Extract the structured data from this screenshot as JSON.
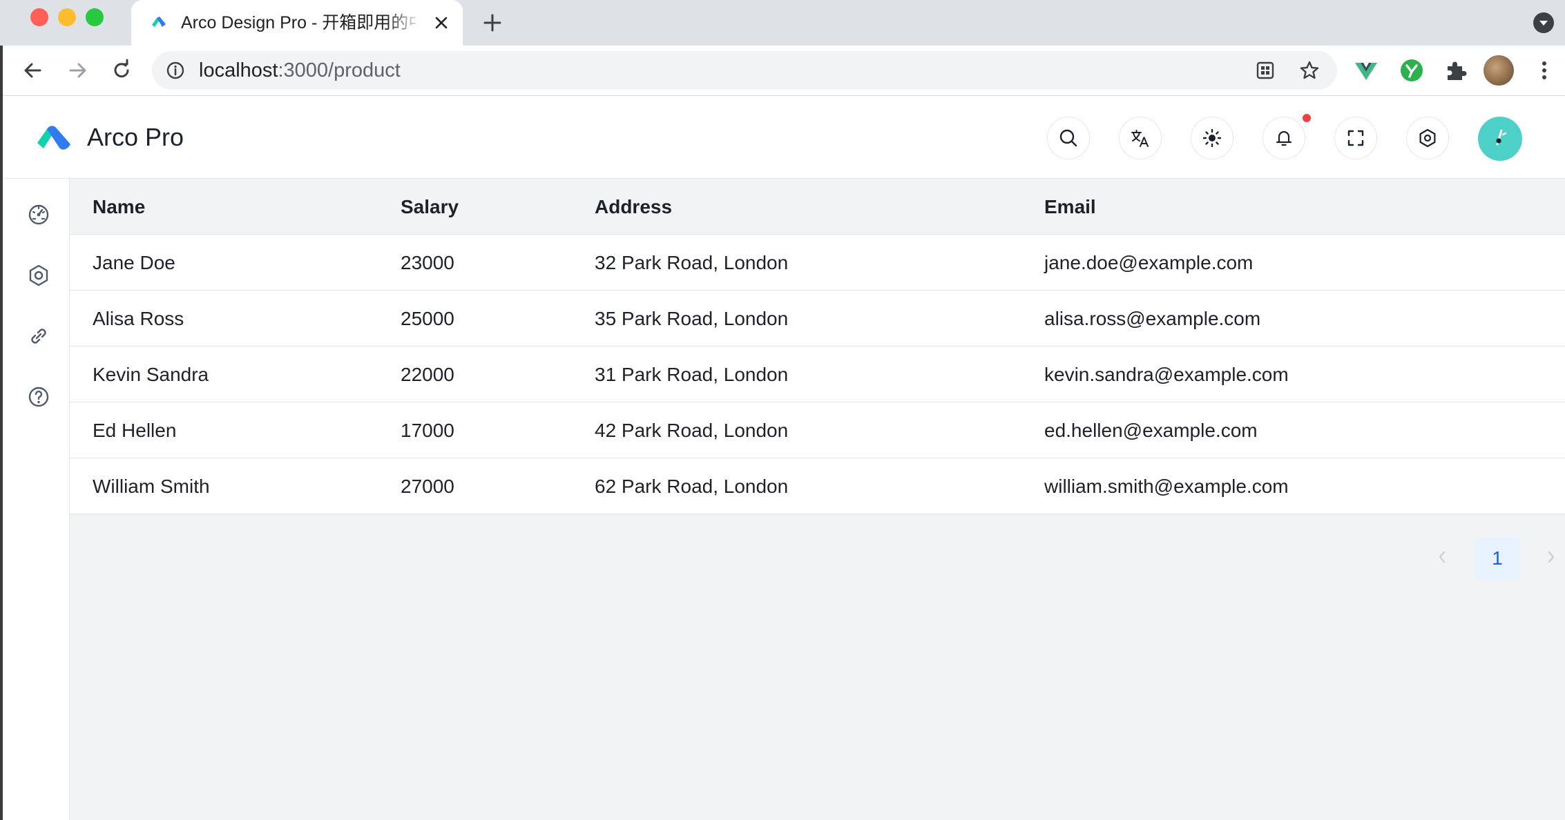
{
  "browser": {
    "tab_title": "Arco Design Pro - 开箱即用的中台前端/设计解决方案",
    "url_host": "localhost",
    "url_path": ":3000/product"
  },
  "app": {
    "title": "Arco Pro"
  },
  "table": {
    "columns": [
      "Name",
      "Salary",
      "Address",
      "Email"
    ],
    "rows": [
      [
        "Jane Doe",
        "23000",
        "32 Park Road, London",
        "jane.doe@example.com"
      ],
      [
        "Alisa Ross",
        "25000",
        "35 Park Road, London",
        "alisa.ross@example.com"
      ],
      [
        "Kevin Sandra",
        "22000",
        "31 Park Road, London",
        "kevin.sandra@example.com"
      ],
      [
        "Ed Hellen",
        "17000",
        "42 Park Road, London",
        "ed.hellen@example.com"
      ],
      [
        "William Smith",
        "27000",
        "62 Park Road, London",
        "william.smith@example.com"
      ]
    ]
  },
  "pagination": {
    "current_page": "1"
  },
  "colors": {
    "primary": "#165dff",
    "avatar_bg": "#4dd0c8",
    "notification_dot": "#f53f3f"
  }
}
